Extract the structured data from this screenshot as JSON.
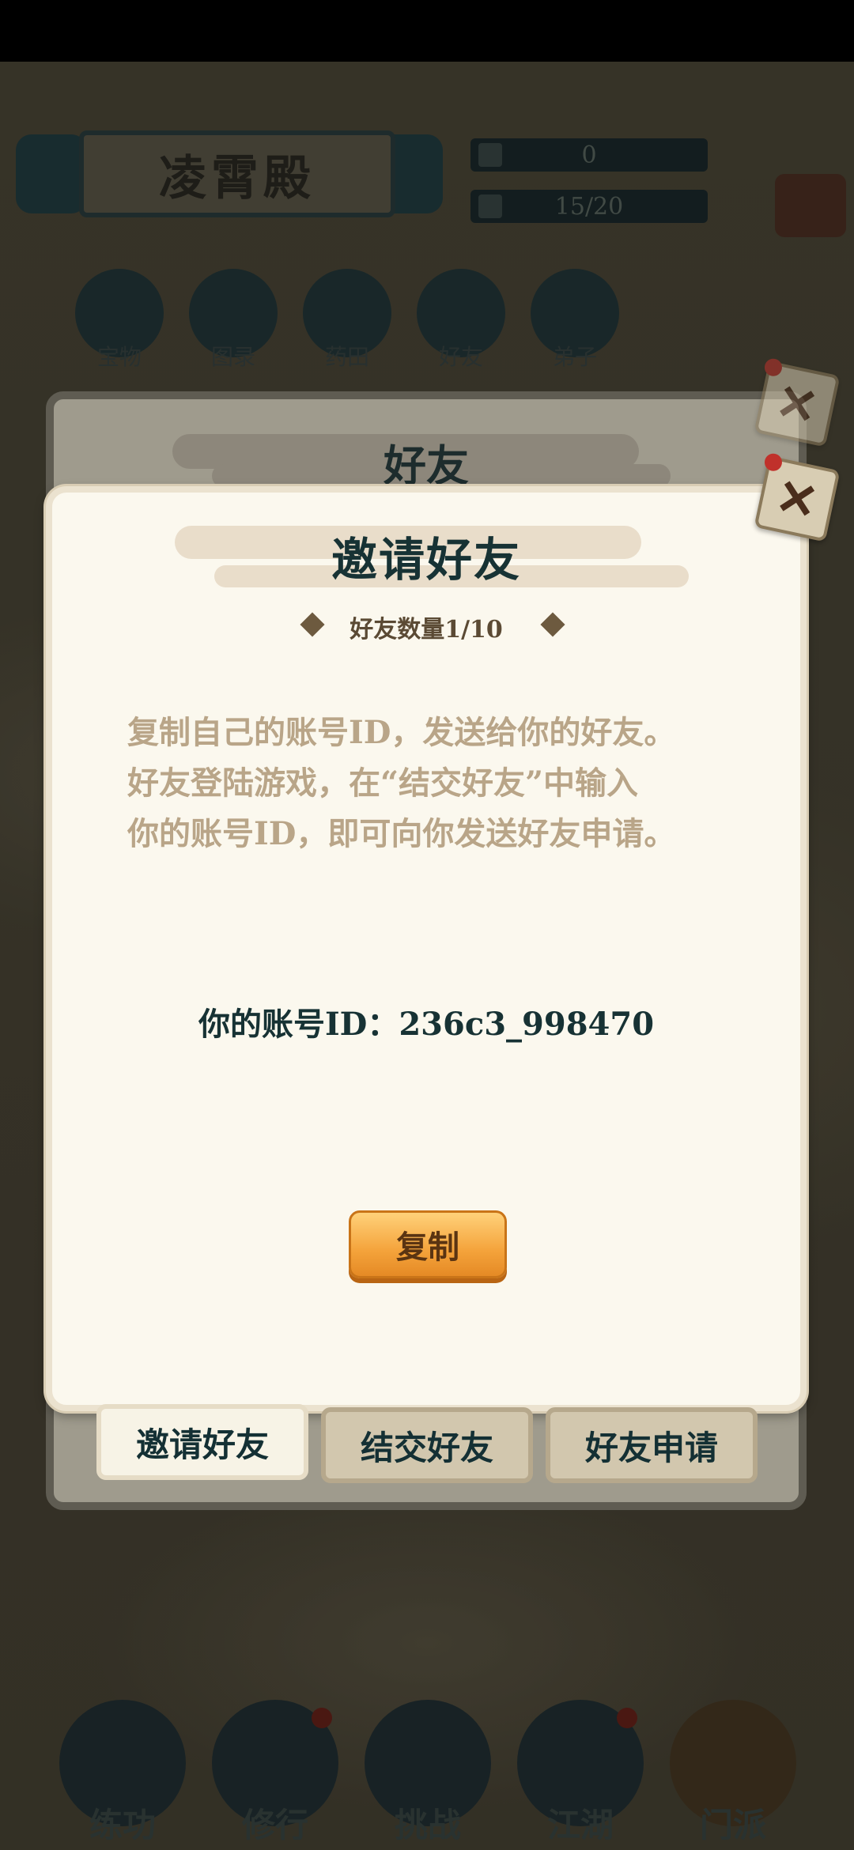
{
  "sect": {
    "name": "凌霄殿"
  },
  "resources": {
    "currency": "0",
    "capacity": "15/20"
  },
  "top_nav": [
    {
      "label": "宝物"
    },
    {
      "label": "图录"
    },
    {
      "label": "药田"
    },
    {
      "label": "好友"
    },
    {
      "label": "弟子"
    }
  ],
  "bottom_nav": [
    {
      "label": "练功"
    },
    {
      "label": "修行"
    },
    {
      "label": "挑战"
    },
    {
      "label": "江湖"
    },
    {
      "label": "门派"
    }
  ],
  "friend_panel": {
    "title": "好友"
  },
  "invite_popup": {
    "title": "邀请好友",
    "friend_count": "好友数量1/10",
    "instructions": [
      "复制自己的账号ID，发送给你的好友。",
      "好友登陆游戏，在“结交好友”中输入",
      "你的账号ID，即可向你发送好友申请。"
    ],
    "account_id_line": "你的账号ID：236c3_998470",
    "copy_label": "复制",
    "close_glyph": "✕"
  },
  "tabs": [
    {
      "label": "邀请好友",
      "active": true
    },
    {
      "label": "结交好友",
      "active": false
    },
    {
      "label": "好友申请",
      "active": false
    }
  ],
  "colors": {
    "accent_orange": "#f4a33b",
    "title_teal": "#173234",
    "instruction_tan": "#b9a588",
    "notification_red": "#6b231a"
  }
}
